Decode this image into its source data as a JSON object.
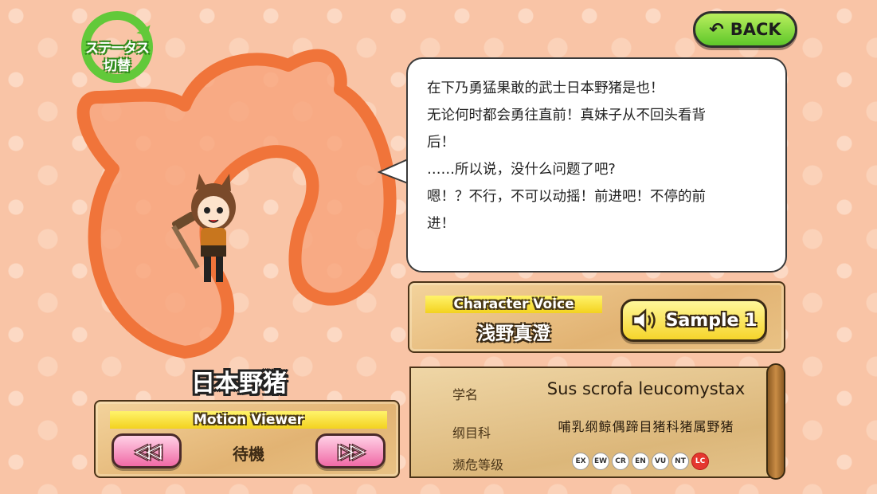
{
  "status_switch": {
    "line1": "ステータス",
    "line2": "切替"
  },
  "back_button": {
    "label": "BACK"
  },
  "dialogue": {
    "lines": [
      "在下乃勇猛果敢的武士日本野猪是也！",
      "无论何时都会勇往直前！真妹子从不回头看背",
      "后！",
      "……所以说，没什么问题了吧?",
      "嗯！？不行，不可以动摇！前进吧！不停的前",
      "进！"
    ]
  },
  "voice": {
    "header": "Character Voice",
    "actor": "浅野真澄",
    "sample_label": "Sample 1"
  },
  "character": {
    "name": "日本野猪"
  },
  "motion_viewer": {
    "header": "Motion Viewer",
    "state": "待機",
    "prev_symbol": "◁◁",
    "next_symbol": "▷▷"
  },
  "info": {
    "scientific_name_label": "学名",
    "scientific_name": "Sus scrofa leucomystax",
    "classification_label": "纲目科",
    "classification": "哺乳纲鲸偶蹄目猪科猪属野猪",
    "status_label": "濒危等级",
    "status_levels": [
      "EX",
      "EW",
      "CR",
      "EN",
      "VU",
      "NT",
      "LC"
    ],
    "status_current": "LC"
  },
  "colors": {
    "background": "#f9c4a6",
    "tail_fill": "#f8a47c",
    "tail_stroke": "#f0743a",
    "back_green": "#5ec72a",
    "status_red": "#e5372f"
  }
}
